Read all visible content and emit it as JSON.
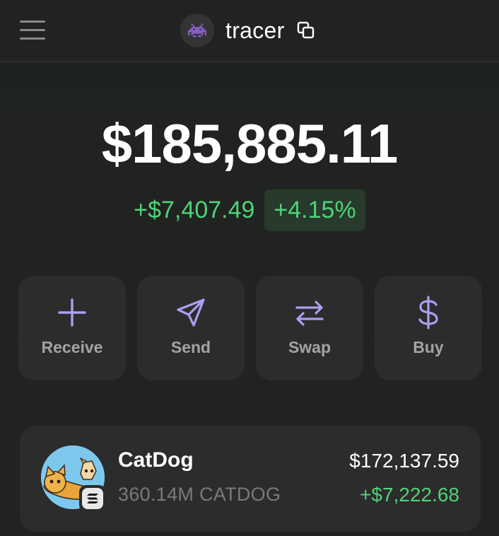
{
  "header": {
    "account_name": "tracer",
    "icons": {
      "menu": "hamburger-menu-icon",
      "avatar": "space-invader-icon",
      "copy": "copy-icon"
    }
  },
  "portfolio": {
    "balance": "$185,885.11",
    "change_amount": "+$7,407.49",
    "change_percent": "+4.15%"
  },
  "actions": [
    {
      "label": "Receive",
      "icon": "plus-icon"
    },
    {
      "label": "Send",
      "icon": "send-arrow-icon"
    },
    {
      "label": "Swap",
      "icon": "swap-arrows-icon"
    },
    {
      "label": "Buy",
      "icon": "dollar-icon"
    }
  ],
  "tokens": [
    {
      "name": "CatDog",
      "amount": "360.14M CATDOG",
      "value": "$172,137.59",
      "change": "+$7,222.68",
      "chain_icon": "solana-icon"
    }
  ],
  "colors": {
    "background": "#222222",
    "card": "#2c2c2c",
    "accent": "#ab9ff2",
    "positive": "#4fd376",
    "positive_bg": "#273a2c",
    "muted_text": "#a3a3a3"
  }
}
